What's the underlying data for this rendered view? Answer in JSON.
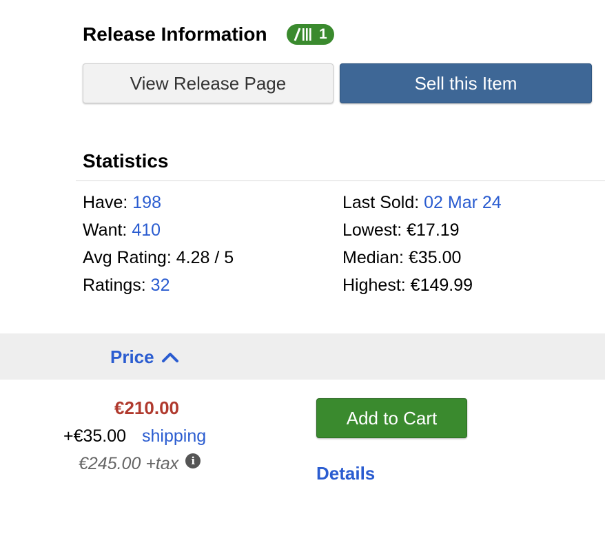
{
  "release": {
    "title": "Release Information",
    "badge_count": "1",
    "view_button": "View Release Page",
    "sell_button": "Sell this Item"
  },
  "statistics": {
    "title": "Statistics",
    "left": [
      {
        "label": "Have:",
        "value": "198"
      },
      {
        "label": "Want:",
        "value": "410"
      },
      {
        "label": "Avg Rating:",
        "value": "4.28 / 5"
      },
      {
        "label": "Ratings:",
        "value": "32"
      }
    ],
    "right": [
      {
        "label": "Last Sold:",
        "value": "02 Mar 24"
      },
      {
        "label": "Lowest:",
        "value": "€17.19"
      },
      {
        "label": "Median:",
        "value": "€35.00"
      },
      {
        "label": "Highest:",
        "value": "€149.99"
      }
    ]
  },
  "price_section": {
    "header": "Price"
  },
  "listing": {
    "price": "€210.00",
    "shipping_amount": "+€35.00",
    "shipping_link": "shipping",
    "total": "€245.00 +tax",
    "add_to_cart": "Add to Cart",
    "details": "Details"
  },
  "icons": {
    "badge": "vinyl-versions-icon",
    "sort": "chevron-up-icon",
    "info": "info-icon"
  },
  "colors": {
    "link": "#2a5cd0",
    "green": "#3a8a2e",
    "sell_blue": "#3e6796",
    "price_red": "#b03a2e"
  }
}
